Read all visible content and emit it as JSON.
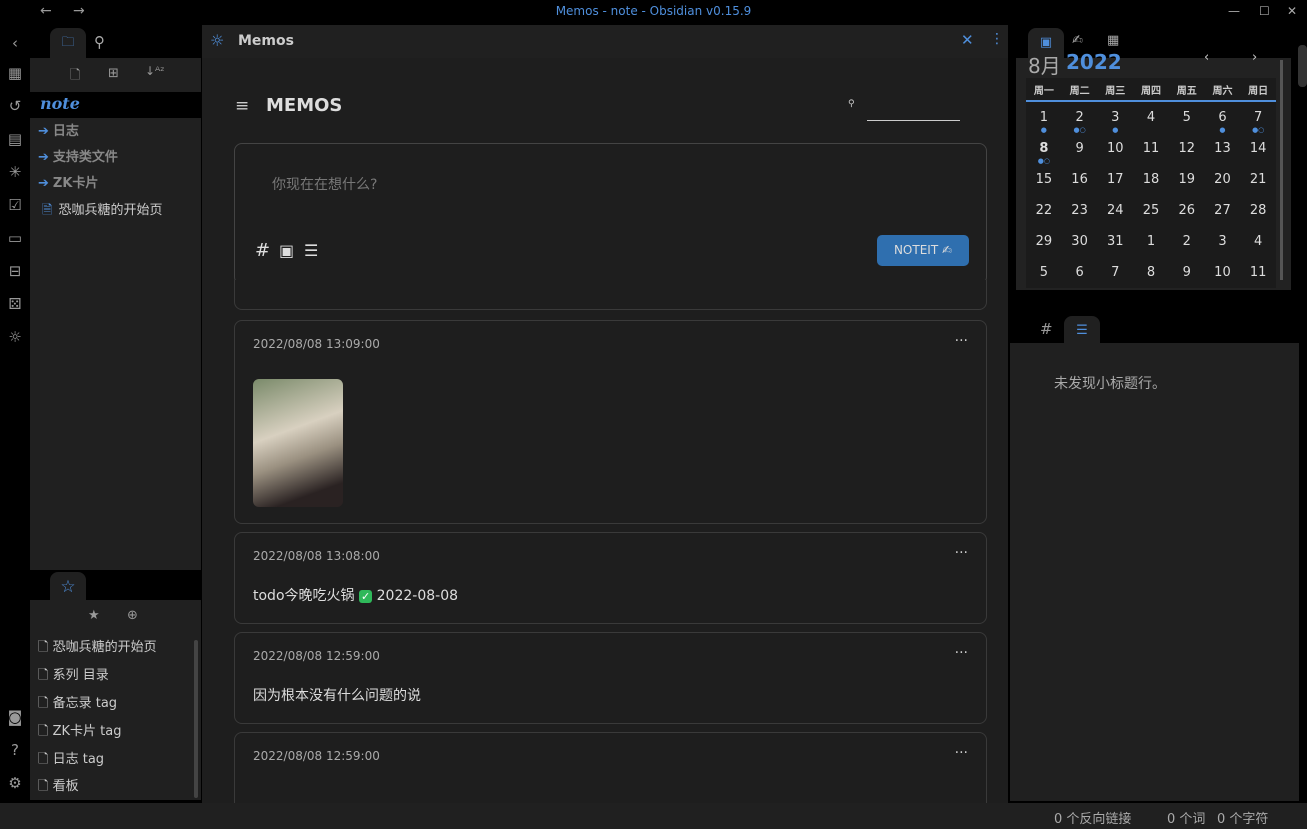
{
  "window": {
    "title": "Memos - note - Obsidian v0.15.9",
    "back": "←",
    "forward": "→"
  },
  "left": {
    "vault": "note",
    "folders": [
      "日志",
      "支持类文件",
      "ZK卡片"
    ],
    "file": "恐咖兵糖的开始页",
    "bookmarks": [
      "恐咖兵糖的开始页",
      "系列 目录",
      "备忘录 tag",
      "ZK卡片 tag",
      "日志 tag",
      "看板"
    ]
  },
  "view": {
    "title": "Memos",
    "heading": "MEMOS",
    "placeholder": "你现在在想什么?",
    "noteit": "NOTEIT ✍",
    "memos": [
      {
        "time": "2022/08/08 13:09:00",
        "text": "",
        "has_image": true
      },
      {
        "time": "2022/08/08 13:08:00",
        "text": "todo今晚吃火锅",
        "done_date": "2022-08-08"
      },
      {
        "time": "2022/08/08 12:59:00",
        "text": "因为根本没有什么问题的说"
      },
      {
        "time": "2022/08/08 12:59:00",
        "text": ""
      }
    ]
  },
  "calendar": {
    "month": "8月",
    "year": "2022",
    "weekdays": [
      "周一",
      "周二",
      "周三",
      "周四",
      "周五",
      "周六",
      "周日"
    ],
    "weeks": [
      [
        "1",
        "2",
        "3",
        "4",
        "5",
        "6",
        "7"
      ],
      [
        "8",
        "9",
        "10",
        "11",
        "12",
        "13",
        "14"
      ],
      [
        "15",
        "16",
        "17",
        "18",
        "19",
        "20",
        "21"
      ],
      [
        "22",
        "23",
        "24",
        "25",
        "26",
        "27",
        "28"
      ],
      [
        "29",
        "30",
        "31",
        "1",
        "2",
        "3",
        "4"
      ],
      [
        "5",
        "6",
        "7",
        "8",
        "9",
        "10",
        "11"
      ]
    ],
    "today": "8",
    "accent": "#4f8fdc"
  },
  "outline": {
    "empty": "未发现小标题行。"
  },
  "status": {
    "backlinks": "0 个反向链接",
    "words": "0 个词",
    "chars": "0 个字符"
  }
}
